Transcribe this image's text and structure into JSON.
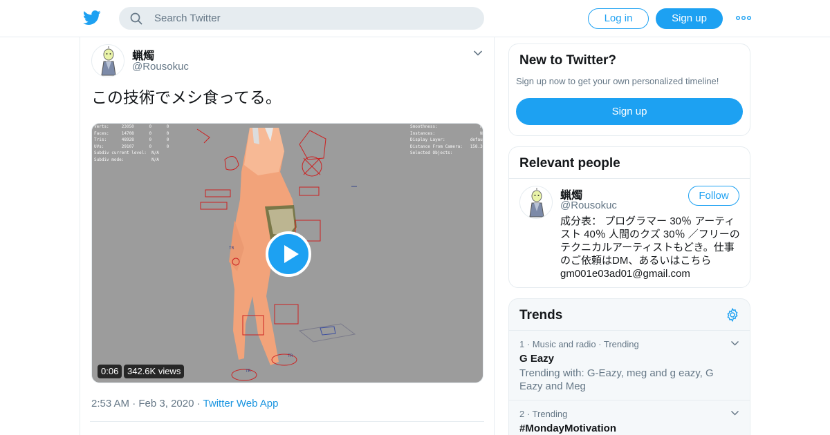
{
  "header": {
    "search_placeholder": "Search Twitter",
    "login_label": "Log in",
    "signup_label": "Sign up"
  },
  "tweet": {
    "display_name": "蝋燭",
    "handle": "@Rousokuc",
    "text": "この技術でメシ食ってる。",
    "video_duration": "0:06",
    "view_count": "342.6K views",
    "time": "2:53 AM",
    "date": "Feb 3, 2020",
    "source": "Twitter Web App",
    "video_stats_left": "Verts:     23050      0      0\nFaces:     14708      0      0\nTris:      48928      0      0\nUVs:       29107      0      0\nSubdiv current level:  N/A\nSubdiv mode:           N/A",
    "video_stats_right": "Smoothness:                 N/A\nInstances:                  N/A\nDisplay Layer:          default\nDistance From Camera:   158.378\nSelected Objects:             1"
  },
  "new_to_twitter": {
    "heading": "New to Twitter?",
    "subtitle": "Sign up now to get your own personalized timeline!",
    "button_label": "Sign up"
  },
  "relevant_people": {
    "heading": "Relevant people",
    "name": "蝋燭",
    "handle": "@Rousokuc",
    "follow_label": "Follow",
    "bio": "成分表： プログラマー 30％ アーティスト 40％ 人間のクズ 30％ ／フリーのテクニカルアーティストもどき。仕事のご依頼はDM、あるいはこちら",
    "bio_email": "gm001e03ad01@gmail.com"
  },
  "trends": {
    "heading": "Trends",
    "items": [
      {
        "category": "1 · Music and radio · Trending",
        "name": "G Eazy",
        "description": "Trending with: G-Eazy, meg and g eazy, G Eazy and Meg"
      },
      {
        "category": "2 · Trending",
        "name": "#MondayMotivation",
        "description": ""
      }
    ]
  },
  "colors": {
    "brand": "#1da1f2",
    "link": "#1b95e0",
    "secondary_text": "#657786",
    "border": "#e6ecf0"
  }
}
